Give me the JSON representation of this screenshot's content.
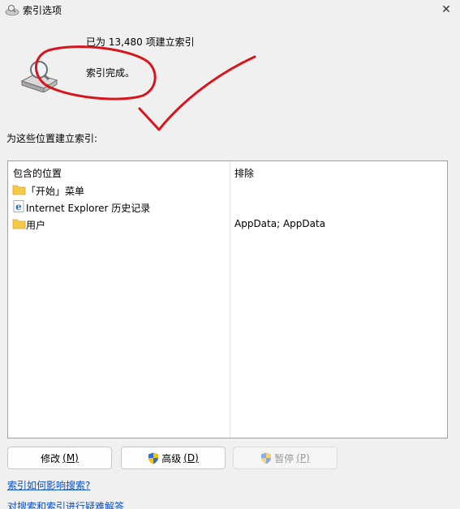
{
  "window": {
    "title": "索引选项",
    "close_glyph": "✕"
  },
  "status": {
    "count_line": "已为 13,480 项建立索引",
    "state_line": "索引完成。"
  },
  "locations": {
    "label": "为这些位置建立索引:",
    "columns": {
      "included": "包含的位置",
      "excluded": "排除"
    },
    "rows": [
      {
        "name": "「开始」菜单",
        "icon": "folder-icon",
        "exclude": ""
      },
      {
        "name": "Internet Explorer 历史记录",
        "icon": "ie-icon",
        "exclude": ""
      },
      {
        "name": "用户",
        "icon": "folder-icon",
        "exclude": "AppData; AppData"
      }
    ]
  },
  "buttons": {
    "modify": {
      "label": "修改",
      "mnemonic": "(M)"
    },
    "advanced": {
      "label": "高级",
      "mnemonic": "(D)"
    },
    "pause": {
      "label": "暂停",
      "mnemonic": "(P)"
    }
  },
  "links": {
    "how_affects": "索引如何影响搜索?",
    "troubleshoot": "对搜索和索引进行疑难解答"
  },
  "colors": {
    "annotation_red": "#d8141c",
    "link_blue": "#0a4fbf",
    "folder_yellow": "#f7c948"
  }
}
